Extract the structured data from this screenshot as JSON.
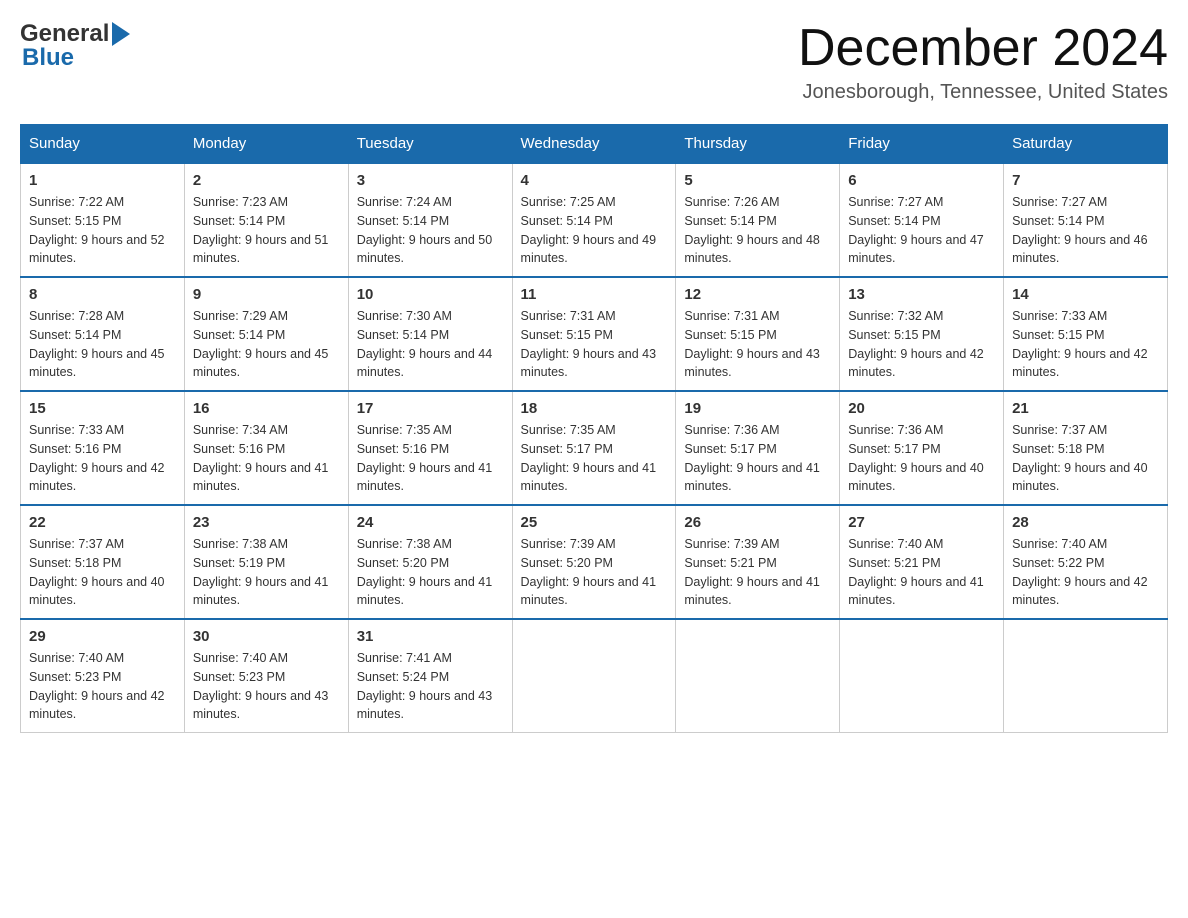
{
  "header": {
    "logo_general": "General",
    "logo_blue": "Blue",
    "month_title": "December 2024",
    "location": "Jonesborough, Tennessee, United States"
  },
  "weekdays": [
    "Sunday",
    "Monday",
    "Tuesday",
    "Wednesday",
    "Thursday",
    "Friday",
    "Saturday"
  ],
  "weeks": [
    [
      {
        "day": "1",
        "sunrise": "7:22 AM",
        "sunset": "5:15 PM",
        "daylight": "9 hours and 52 minutes."
      },
      {
        "day": "2",
        "sunrise": "7:23 AM",
        "sunset": "5:14 PM",
        "daylight": "9 hours and 51 minutes."
      },
      {
        "day": "3",
        "sunrise": "7:24 AM",
        "sunset": "5:14 PM",
        "daylight": "9 hours and 50 minutes."
      },
      {
        "day": "4",
        "sunrise": "7:25 AM",
        "sunset": "5:14 PM",
        "daylight": "9 hours and 49 minutes."
      },
      {
        "day": "5",
        "sunrise": "7:26 AM",
        "sunset": "5:14 PM",
        "daylight": "9 hours and 48 minutes."
      },
      {
        "day": "6",
        "sunrise": "7:27 AM",
        "sunset": "5:14 PM",
        "daylight": "9 hours and 47 minutes."
      },
      {
        "day": "7",
        "sunrise": "7:27 AM",
        "sunset": "5:14 PM",
        "daylight": "9 hours and 46 minutes."
      }
    ],
    [
      {
        "day": "8",
        "sunrise": "7:28 AM",
        "sunset": "5:14 PM",
        "daylight": "9 hours and 45 minutes."
      },
      {
        "day": "9",
        "sunrise": "7:29 AM",
        "sunset": "5:14 PM",
        "daylight": "9 hours and 45 minutes."
      },
      {
        "day": "10",
        "sunrise": "7:30 AM",
        "sunset": "5:14 PM",
        "daylight": "9 hours and 44 minutes."
      },
      {
        "day": "11",
        "sunrise": "7:31 AM",
        "sunset": "5:15 PM",
        "daylight": "9 hours and 43 minutes."
      },
      {
        "day": "12",
        "sunrise": "7:31 AM",
        "sunset": "5:15 PM",
        "daylight": "9 hours and 43 minutes."
      },
      {
        "day": "13",
        "sunrise": "7:32 AM",
        "sunset": "5:15 PM",
        "daylight": "9 hours and 42 minutes."
      },
      {
        "day": "14",
        "sunrise": "7:33 AM",
        "sunset": "5:15 PM",
        "daylight": "9 hours and 42 minutes."
      }
    ],
    [
      {
        "day": "15",
        "sunrise": "7:33 AM",
        "sunset": "5:16 PM",
        "daylight": "9 hours and 42 minutes."
      },
      {
        "day": "16",
        "sunrise": "7:34 AM",
        "sunset": "5:16 PM",
        "daylight": "9 hours and 41 minutes."
      },
      {
        "day": "17",
        "sunrise": "7:35 AM",
        "sunset": "5:16 PM",
        "daylight": "9 hours and 41 minutes."
      },
      {
        "day": "18",
        "sunrise": "7:35 AM",
        "sunset": "5:17 PM",
        "daylight": "9 hours and 41 minutes."
      },
      {
        "day": "19",
        "sunrise": "7:36 AM",
        "sunset": "5:17 PM",
        "daylight": "9 hours and 41 minutes."
      },
      {
        "day": "20",
        "sunrise": "7:36 AM",
        "sunset": "5:17 PM",
        "daylight": "9 hours and 40 minutes."
      },
      {
        "day": "21",
        "sunrise": "7:37 AM",
        "sunset": "5:18 PM",
        "daylight": "9 hours and 40 minutes."
      }
    ],
    [
      {
        "day": "22",
        "sunrise": "7:37 AM",
        "sunset": "5:18 PM",
        "daylight": "9 hours and 40 minutes."
      },
      {
        "day": "23",
        "sunrise": "7:38 AM",
        "sunset": "5:19 PM",
        "daylight": "9 hours and 41 minutes."
      },
      {
        "day": "24",
        "sunrise": "7:38 AM",
        "sunset": "5:20 PM",
        "daylight": "9 hours and 41 minutes."
      },
      {
        "day": "25",
        "sunrise": "7:39 AM",
        "sunset": "5:20 PM",
        "daylight": "9 hours and 41 minutes."
      },
      {
        "day": "26",
        "sunrise": "7:39 AM",
        "sunset": "5:21 PM",
        "daylight": "9 hours and 41 minutes."
      },
      {
        "day": "27",
        "sunrise": "7:40 AM",
        "sunset": "5:21 PM",
        "daylight": "9 hours and 41 minutes."
      },
      {
        "day": "28",
        "sunrise": "7:40 AM",
        "sunset": "5:22 PM",
        "daylight": "9 hours and 42 minutes."
      }
    ],
    [
      {
        "day": "29",
        "sunrise": "7:40 AM",
        "sunset": "5:23 PM",
        "daylight": "9 hours and 42 minutes."
      },
      {
        "day": "30",
        "sunrise": "7:40 AM",
        "sunset": "5:23 PM",
        "daylight": "9 hours and 43 minutes."
      },
      {
        "day": "31",
        "sunrise": "7:41 AM",
        "sunset": "5:24 PM",
        "daylight": "9 hours and 43 minutes."
      },
      null,
      null,
      null,
      null
    ]
  ],
  "labels": {
    "sunrise_prefix": "Sunrise: ",
    "sunset_prefix": "Sunset: ",
    "daylight_prefix": "Daylight: "
  }
}
